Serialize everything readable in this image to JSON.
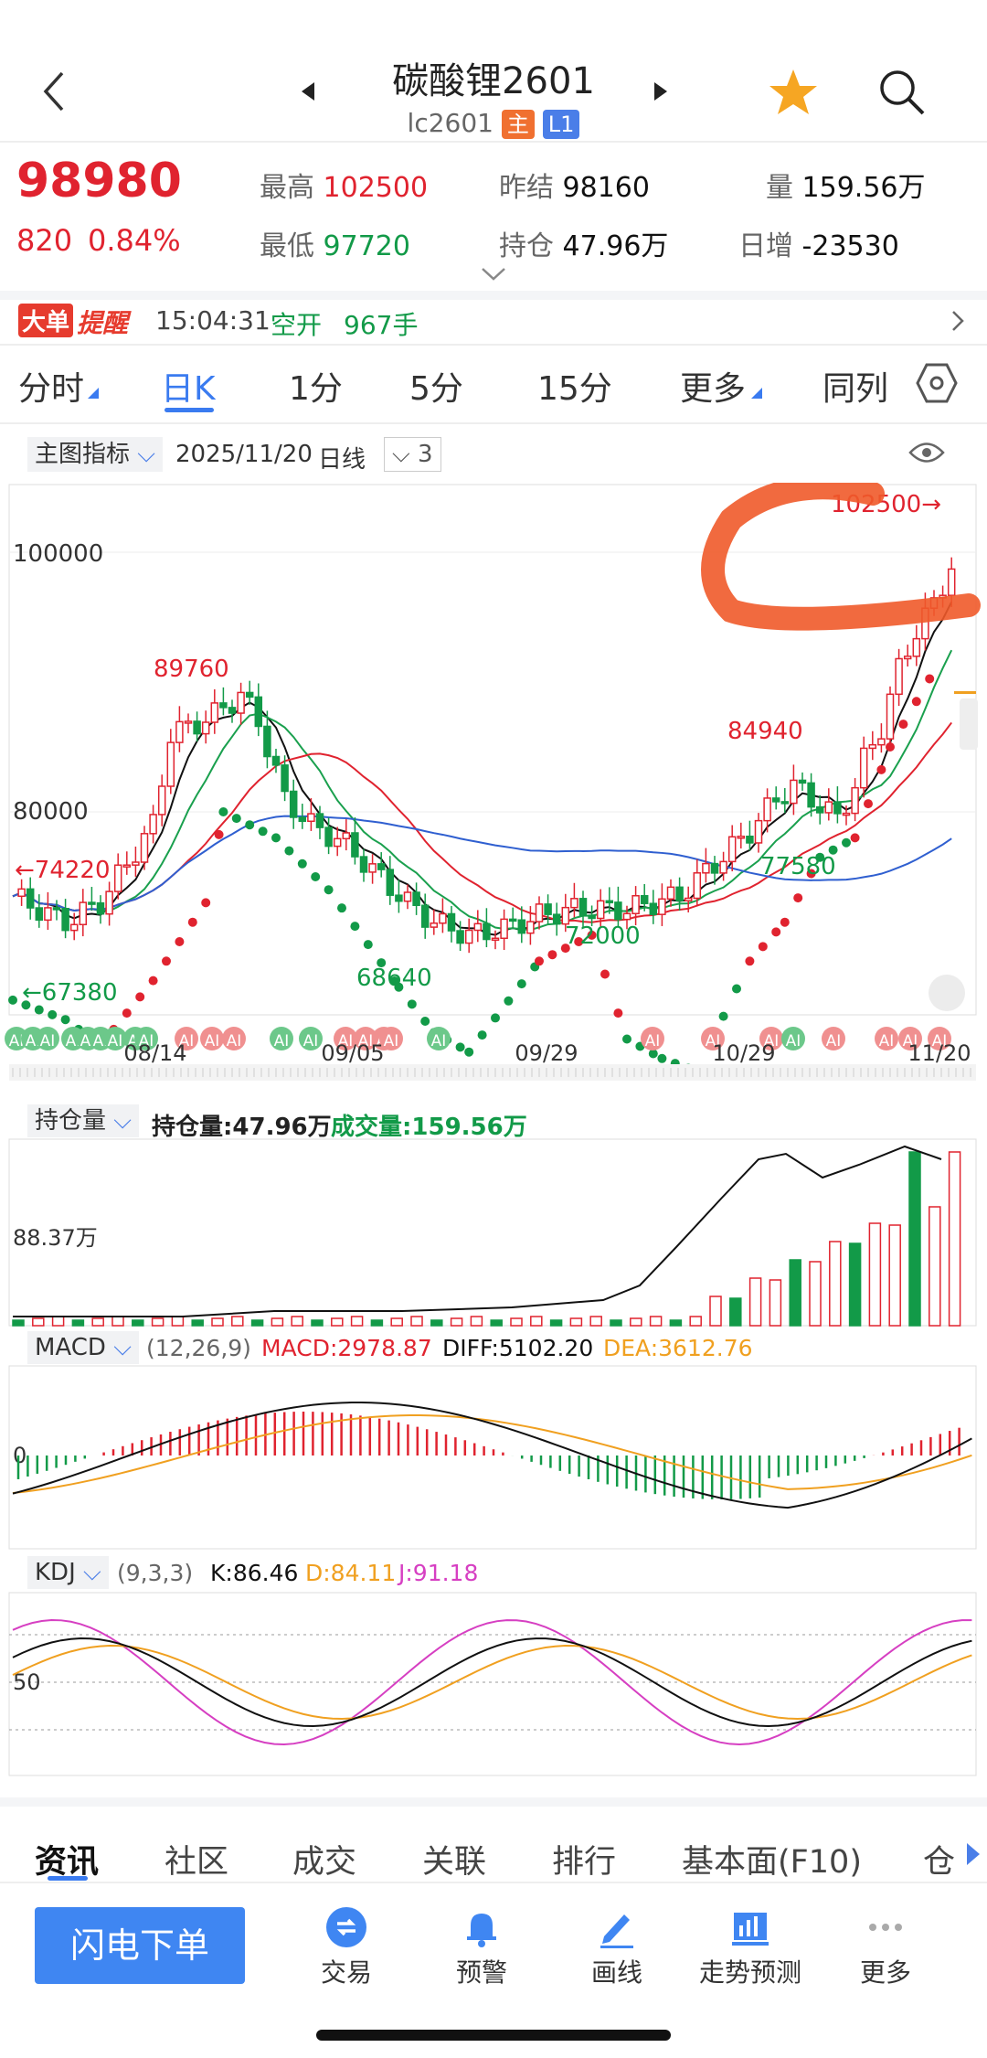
{
  "header": {
    "title": "碳酸锂2601",
    "code": "lc2601",
    "tag_main": "主",
    "tag_level": "L1"
  },
  "quote": {
    "last": "98980",
    "change": "820",
    "change_pct": "0.84%",
    "high_label": "最高",
    "high": "102500",
    "low_label": "最低",
    "low": "97720",
    "prev_settle_label": "昨结",
    "prev_settle": "98160",
    "oi_label": "持仓",
    "oi": "47.96万",
    "volume_label": "量",
    "volume": "159.56万",
    "daily_inc_label": "日增",
    "daily_inc": "-23530"
  },
  "alert": {
    "badge_big": "大单",
    "badge_remind": "提醒",
    "time": "15:04:31",
    "type": "空开",
    "qty": "967手"
  },
  "tabs": [
    "分时",
    "日K",
    "1分",
    "5分",
    "15分",
    "更多",
    "同列"
  ],
  "active_tab": "日K",
  "chart_toolbar": {
    "indicator_label": "主图指标",
    "date": "2025/11/20",
    "period": "日线",
    "count": "3"
  },
  "main_chart": {
    "y_labels": [
      "100000",
      "80000"
    ],
    "annotations": {
      "high": "102500→",
      "p1": "89760",
      "p2": "←74220",
      "p3": "←67380",
      "p4": "68640",
      "p5": "72000",
      "p6": "84940",
      "p7": "77580"
    },
    "ai_badge": "AI",
    "x_labels": [
      "08/14",
      "09/05",
      "09/29",
      "10/29",
      "11/20"
    ]
  },
  "oi_panel": {
    "selector": "持仓量",
    "oi_label": "持仓量:47.96万",
    "vol_label": "成交量:159.56万",
    "y_label": "88.37万"
  },
  "macd_panel": {
    "selector": "MACD",
    "params": "(12,26,9)",
    "macd": "MACD:2978.87",
    "diff": "DIFF:5102.20",
    "dea": "DEA:3612.76",
    "zero": "0"
  },
  "kdj_panel": {
    "selector": "KDJ",
    "params": "(9,3,3)",
    "k": "K:86.46",
    "d": "D:84.11",
    "j": "J:91.18",
    "y_label": "50"
  },
  "bottom_tabs": [
    "资讯",
    "社区",
    "成交",
    "关联",
    "排行",
    "基本面(F10)",
    "仓"
  ],
  "toolbar": {
    "order_button": "闪电下单",
    "items": [
      "交易",
      "预警",
      "画线",
      "走势预测",
      "更多"
    ]
  },
  "colors": {
    "up": "#e0232f",
    "down": "#129a48",
    "accent": "#3a7bf0",
    "orange": "#f0a020",
    "magenta": "#d63fc2"
  }
}
